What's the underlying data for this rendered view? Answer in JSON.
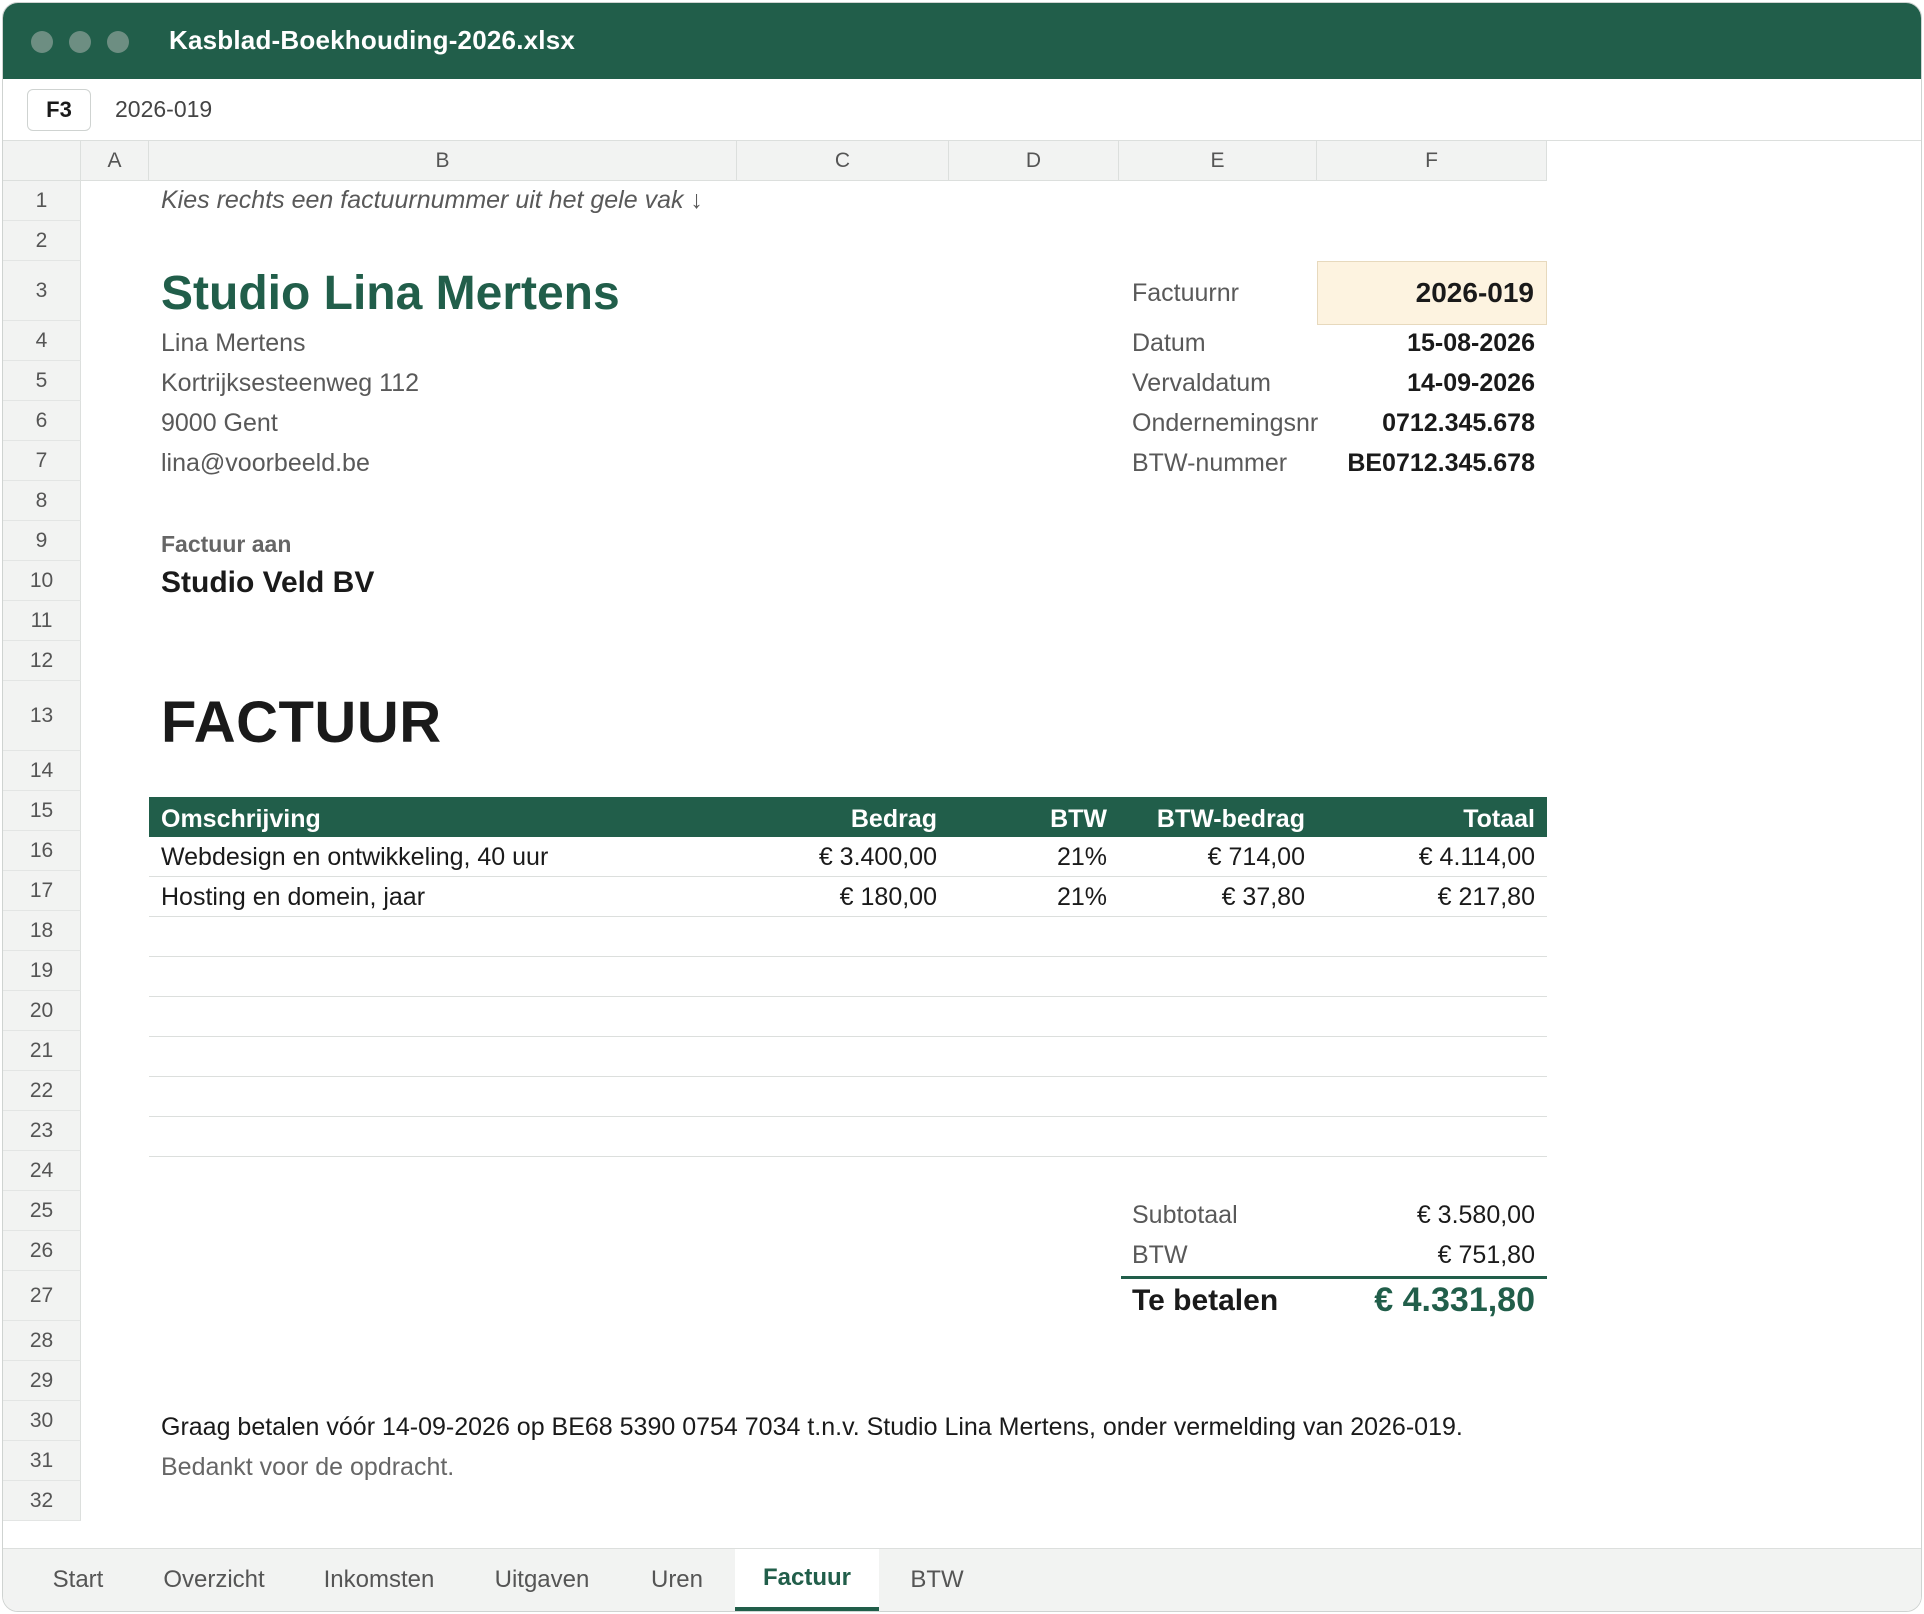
{
  "window": {
    "title": "Kasblad-Boekhouding-2026.xlsx"
  },
  "formula_bar": {
    "cell_ref": "F3",
    "value": "2026-019"
  },
  "columns": [
    "A",
    "B",
    "C",
    "D",
    "E",
    "F"
  ],
  "rows": [
    "1",
    "2",
    "3",
    "4",
    "5",
    "6",
    "7",
    "8",
    "9",
    "10",
    "11",
    "12",
    "13",
    "14",
    "15",
    "16",
    "17",
    "18",
    "19",
    "20",
    "21",
    "22",
    "23",
    "24",
    "25",
    "26",
    "27",
    "28",
    "29",
    "30",
    "31",
    "32"
  ],
  "sheet": {
    "hint": "Kies rechts een factuurnummer uit het gele vak ↓",
    "sender": {
      "brand": "Studio Lina Mertens",
      "name": "Lina Mertens",
      "street": "Kortrijksesteenweg 112",
      "city": "9000 Gent",
      "email": "lina@voorbeeld.be"
    },
    "meta": [
      {
        "label": "Factuurnr",
        "value": "2026-019"
      },
      {
        "label": "Datum",
        "value": "15-08-2026"
      },
      {
        "label": "Vervaldatum",
        "value": "14-09-2026"
      },
      {
        "label": "Ondernemingsnr",
        "value": "0712.345.678"
      },
      {
        "label": "BTW-nummer",
        "value": "BE0712.345.678"
      }
    ],
    "bill_to_label": "Factuur aan",
    "client": "Studio Veld BV",
    "heading": "FACTUUR",
    "table": {
      "headers": [
        "Omschrijving",
        "Bedrag",
        "BTW",
        "BTW-bedrag",
        "Totaal"
      ],
      "rows": [
        [
          "Webdesign en ontwikkeling, 40 uur",
          "€ 3.400,00",
          "21%",
          "€ 714,00",
          "€ 4.114,00"
        ],
        [
          "Hosting en domein, jaar",
          "€ 180,00",
          "21%",
          "€ 37,80",
          "€ 217,80"
        ]
      ]
    },
    "summary": {
      "subtotal_label": "Subtotaal",
      "subtotal": "€ 3.580,00",
      "vat_label": "BTW",
      "vat": "€ 751,80",
      "total_label": "Te betalen",
      "total": "€ 4.331,80"
    },
    "note": "Graag betalen vóór 14-09-2026 op BE68 5390 0754 7034 t.n.v. Studio Lina Mertens, onder vermelding van 2026-019.",
    "thanks": "Bedankt voor de opdracht."
  },
  "tabs": [
    "Start",
    "Overzicht",
    "Inkomsten",
    "Uitgaven",
    "Uren",
    "Factuur",
    "BTW"
  ],
  "active_tab": "Factuur",
  "colors": {
    "accent": "#215e4a",
    "highlight": "#fdf3e0"
  }
}
